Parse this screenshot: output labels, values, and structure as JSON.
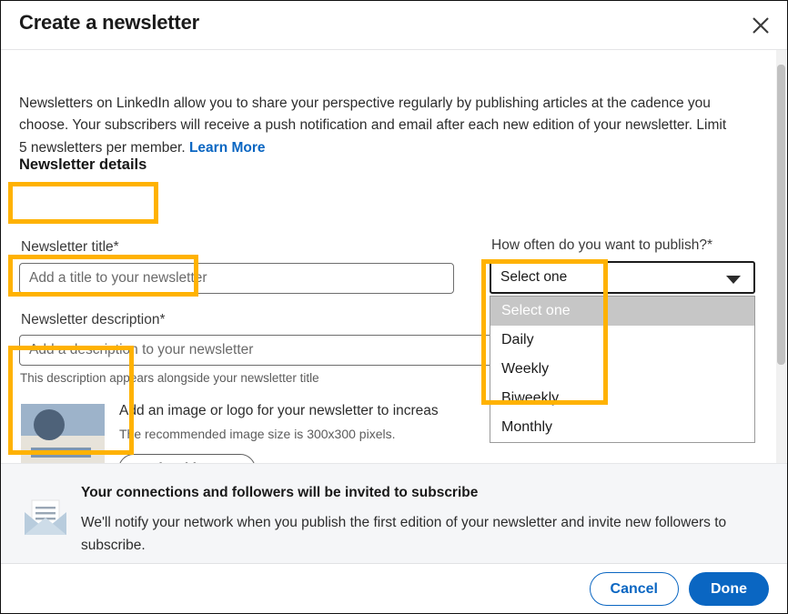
{
  "header": {
    "title": "Create a newsletter",
    "close_icon": "close-icon"
  },
  "intro": {
    "text": "Newsletters on LinkedIn allow you to share your perspective regularly by publishing articles at the cadence you choose. Your subscribers will receive a push notification and email after each new edition of your newsletter. Limit 5 newsletters per member. ",
    "link_label": "Learn More"
  },
  "section": {
    "heading": "Newsletter details"
  },
  "fields": {
    "title": {
      "label": "Newsletter title*",
      "placeholder": "Add a title to your newsletter",
      "value": ""
    },
    "description": {
      "label": "Newsletter description*",
      "placeholder": "Add a description to your newsletter",
      "value": "",
      "helper": "This description appears alongside your newsletter title"
    },
    "cadence": {
      "label": "How often do you want to publish?*",
      "selected": "Select one",
      "caret_icon": "chevron-down-icon",
      "options": [
        "Select one",
        "Daily",
        "Weekly",
        "Biweekly",
        "Monthly"
      ],
      "highlighted_option": "Select one"
    }
  },
  "image_section": {
    "thumbnail_icon": "image-placeholder-icon",
    "prompt": "Add an image or logo for your newsletter to increas",
    "hint": "The recommended image size is 300x300 pixels.",
    "upload_label": "Upload image"
  },
  "banner": {
    "icon": "envelope-icon",
    "title": "Your connections and followers will be invited to subscribe",
    "text": "We'll notify your network when you publish the first edition of your newsletter and invite new followers to subscribe."
  },
  "footer": {
    "cancel_label": "Cancel",
    "done_label": "Done"
  },
  "colors": {
    "accent_blue": "#0a66c2",
    "highlight_orange": "#ffb200",
    "banner_bg": "#f5f6f8",
    "option_highlight": "#c6c6c6"
  }
}
